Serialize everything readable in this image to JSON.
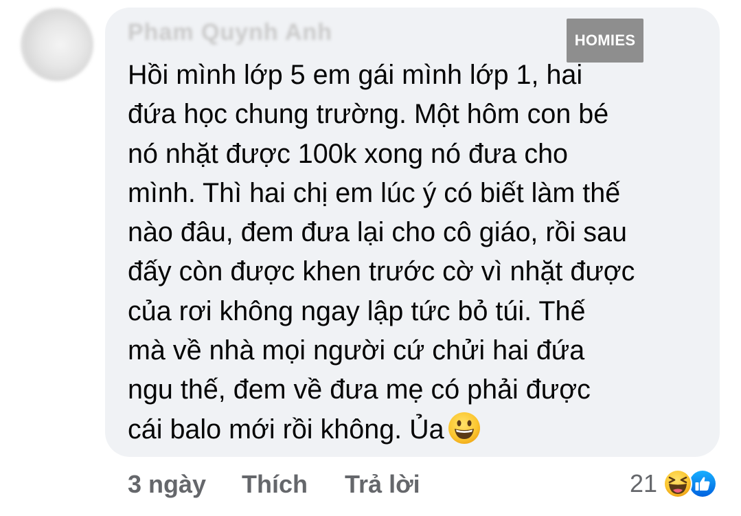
{
  "comment": {
    "author": "Pham Quynh Anh",
    "badge": "HOMIES",
    "lines": [
      "Hồi mình lớp 5 em gái mình lớp 1, hai",
      "đứa học chung trường. Một hôm con bé",
      "nó nhặt được 100k xong nó đưa cho",
      "mình. Thì hai chị em lúc ý có biết làm thế",
      "nào đâu, đem đưa lại cho cô giáo, rồi sau",
      "đấy còn được khen trước cờ vì nhặt được",
      "của rơi không ngay lập tức bỏ túi. Thế",
      "mà về nhà mọi người cứ chửi hai đứa",
      "ngu thế, đem về đưa mẹ có phải được",
      "cái balo mới rồi không. Ủa"
    ],
    "trailing_emoji": "grinning-face-emoji"
  },
  "actions": {
    "time": "3 ngày",
    "like_label": "Thích",
    "reply_label": "Trả lời"
  },
  "reactions": {
    "count": "21",
    "icons": [
      "haha-reaction-icon",
      "like-reaction-icon"
    ]
  },
  "colors": {
    "bubble": "#f0f2f5",
    "text": "#050505",
    "meta": "#65676b",
    "badge": "#8e8e8e",
    "like_blue": "#1877f2",
    "emoji_yellow": "#fbc630"
  }
}
